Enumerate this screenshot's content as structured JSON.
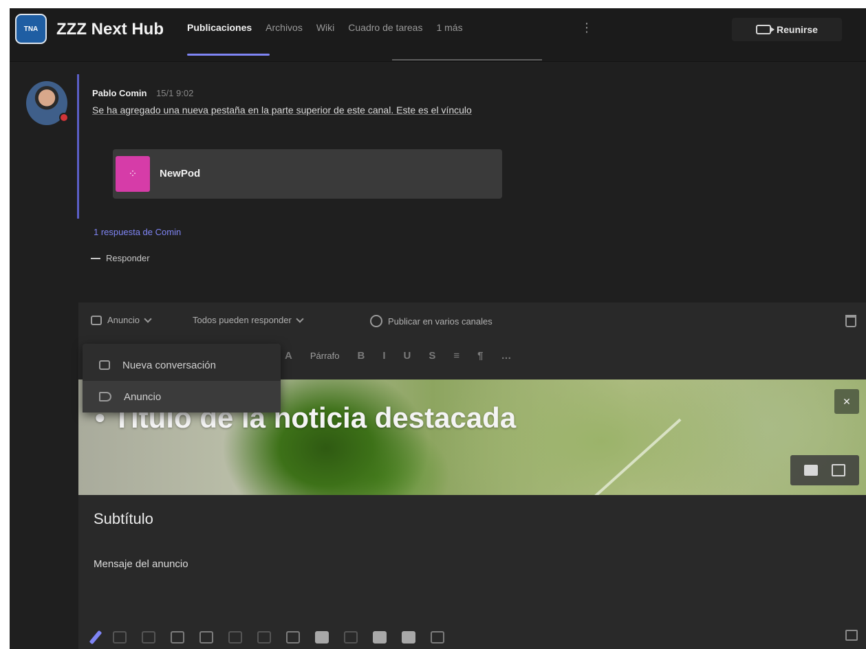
{
  "header": {
    "team_badge": "TNA",
    "team_name": "ZZZ Next Hub",
    "tabs": [
      {
        "label": "Publicaciones",
        "active": true
      },
      {
        "label": "Archivos",
        "active": false
      },
      {
        "label": "Wiki",
        "active": false
      },
      {
        "label": "Cuadro de tareas",
        "active": false
      },
      {
        "label": "1 más",
        "active": false
      }
    ],
    "more_label": "⋮",
    "meet_label": "Reunirse"
  },
  "post": {
    "author": "Pablo Comin",
    "time": "15/1 9:02",
    "text": "Se ha agregado una nueva pestaña en la parte superior de este canal. Este es el vínculo",
    "card": {
      "icon_glyph": "⁘",
      "title": "NewPod"
    },
    "replies_link": "1 respuesta de Comin",
    "reply_label": "Responder"
  },
  "composer": {
    "top_items": [
      "Anuncio",
      "Todos pueden responder",
      "Publicar en varios canales"
    ],
    "toolbar": [
      "A",
      "Párrafo",
      "B",
      "I",
      "U",
      "S",
      "≡",
      "¶",
      "…"
    ],
    "menu": [
      {
        "label": "Nueva conversación",
        "selected": false
      },
      {
        "label": "Anuncio",
        "selected": true
      }
    ],
    "banner_title": "• Título de la noticia destacada",
    "banner_btn": "✕",
    "subtitle": "Subtítulo",
    "message": "Mensaje del anuncio"
  },
  "colors": {
    "accent": "#7f85f5",
    "app_icon": "#d63ca8",
    "presence_busy": "#d13438",
    "background": "#1f1f1f"
  }
}
